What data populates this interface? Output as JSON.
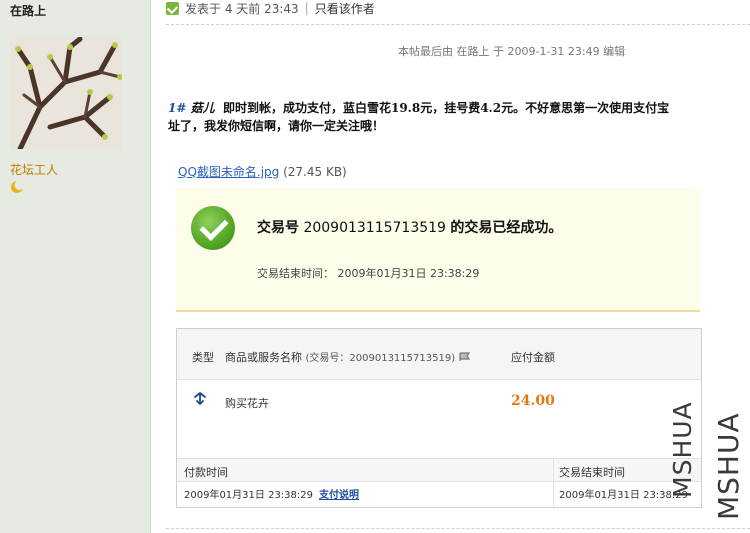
{
  "sidebar": {
    "username": "在路上",
    "rank": "花坛工人",
    "rank_icon": "moon-icon"
  },
  "post": {
    "posted_text": "发表于 4 天前 23:43",
    "separator": "|",
    "only_author_label": "只看该作者",
    "edit_note": "本帖最后由 在路上 于 2009-1-31 23:49 编辑",
    "floor": "1#",
    "nick": "菇儿",
    "body_line1": "即时到帐，成功支付，蓝白雪花19.8元，挂号费4.2元。不好意思第一次使用支付宝",
    "body_line2": "址了，我发你短信啊，请你一定关注哦！",
    "attachment_name": "QQ截图未命名.jpg",
    "attachment_size": "(27.45 KB)"
  },
  "receipt": {
    "trade_label": "交易号",
    "trade_no": "2009013115713519",
    "trade_status": "的交易已经成功。",
    "end_time_text": "交易结束时间： 2009年01月31日 23:38:29",
    "col_type": "类型",
    "col_name": "商品或服务名称",
    "col_name_trade": "(交易号：2009013115713519)",
    "col_amount": "应付金额",
    "item_name": "购买花卉",
    "item_amount": "24.00",
    "pay_time_label": "付款时间",
    "end_time_label": "交易结束时间",
    "pay_time": "2009年01月31日 23:38:29",
    "pay_link": "支付说明",
    "end_time": "2009年01月31日 23:38:29"
  },
  "watermark": {
    "text1": "MSHUA",
    "text2": "MSHUA"
  },
  "colors": {
    "sidebar_bg": "#e5ebe2",
    "rank_color": "#c17a00",
    "floor_color": "#1f4fa0",
    "success_bg": "#fdfdea",
    "amount_color": "#e07a16"
  }
}
